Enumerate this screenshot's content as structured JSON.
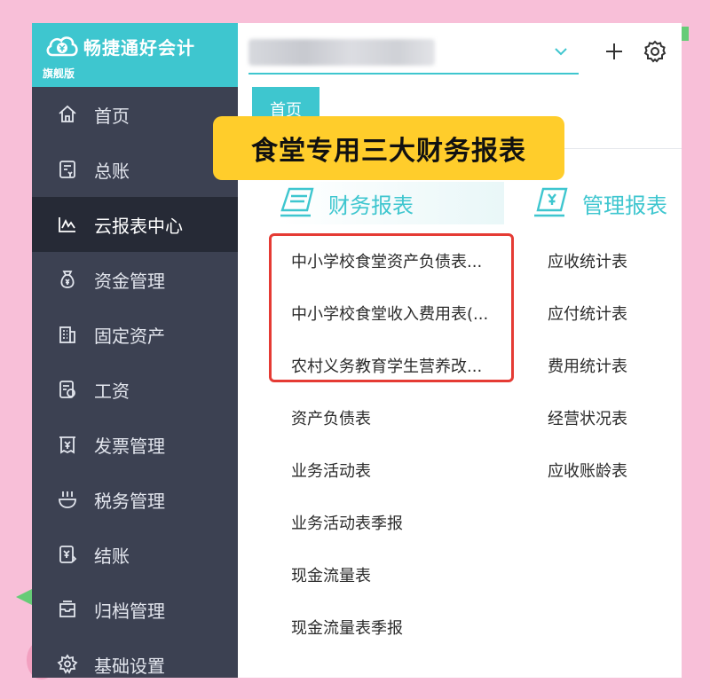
{
  "brand": {
    "name": "畅捷通好会计",
    "edition": "旗舰版",
    "logo_icon": "cloud-coin-icon"
  },
  "sidebar": {
    "items": [
      {
        "label": "首页",
        "icon": "home-icon"
      },
      {
        "label": "总账",
        "icon": "ledger-icon"
      },
      {
        "label": "云报表中心",
        "icon": "chart-line-icon",
        "active": true
      },
      {
        "label": "资金管理",
        "icon": "money-bag-icon"
      },
      {
        "label": "固定资产",
        "icon": "building-icon"
      },
      {
        "label": "工资",
        "icon": "salary-icon"
      },
      {
        "label": "发票管理",
        "icon": "invoice-icon"
      },
      {
        "label": "税务管理",
        "icon": "tax-icon"
      },
      {
        "label": "结账",
        "icon": "checkout-icon"
      },
      {
        "label": "归档管理",
        "icon": "archive-icon"
      },
      {
        "label": "基础设置",
        "icon": "gear-icon"
      }
    ]
  },
  "header": {
    "account_icon": "chevron-down-icon",
    "add_icon": "plus-icon",
    "settings_icon": "gear-icon"
  },
  "tabs": [
    {
      "label": "首页"
    }
  ],
  "banner": {
    "text": "食堂专用三大财务报表"
  },
  "financial_reports": {
    "title": "财务报表",
    "items": [
      "中小学校食堂资产负债表...",
      "中小学校食堂收入费用表(...",
      "农村义务教育学生营养改...",
      "资产负债表",
      "业务活动表",
      "业务活动表季报",
      "现金流量表",
      "现金流量表季报"
    ]
  },
  "management_reports": {
    "title": "管理报表",
    "items": [
      "应收统计表",
      "应付统计表",
      "费用统计表",
      "经营状况表",
      "应收账龄表"
    ]
  },
  "colors": {
    "accent": "#3ec6cf",
    "sidebar": "#3c4152",
    "sidebar_active": "#262a36",
    "banner": "#ffcd2b",
    "highlight": "#e53b34",
    "background": "#f8bfd8"
  }
}
